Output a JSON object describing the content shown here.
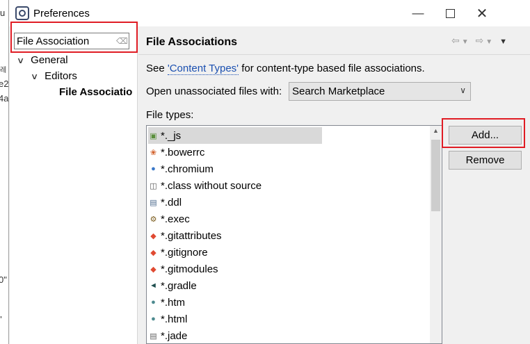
{
  "window": {
    "title": "Preferences"
  },
  "background_fragments": [
    "u",
    "레",
    "e2",
    "4a",
    "0\"",
    "\""
  ],
  "sidebar": {
    "filter_value": "File Association",
    "tree": [
      {
        "label": "General",
        "expanded": true
      },
      {
        "label": "Editors",
        "expanded": true
      },
      {
        "label": "File Associatio",
        "selected": true
      }
    ]
  },
  "page": {
    "title": "File Associations",
    "see_prefix": "See ",
    "see_link": "'Content Types'",
    "see_suffix": " for content-type based file associations.",
    "open_label": "Open unassociated files with:",
    "open_value": "Search Marketplace",
    "file_types_label": "File types:",
    "file_types": [
      {
        "name": "*._js",
        "icon": "node-js-icon",
        "selected": true
      },
      {
        "name": "*.bowerrc",
        "icon": "bower-icon"
      },
      {
        "name": "*.chromium",
        "icon": "chromium-icon"
      },
      {
        "name": "*.class without source",
        "icon": "class-file-icon"
      },
      {
        "name": "*.ddl",
        "icon": "ddl-file-icon"
      },
      {
        "name": "*.exec",
        "icon": "exec-gears-icon"
      },
      {
        "name": "*.gitattributes",
        "icon": "git-icon"
      },
      {
        "name": "*.gitignore",
        "icon": "git-icon"
      },
      {
        "name": "*.gitmodules",
        "icon": "git-icon"
      },
      {
        "name": "*.gradle",
        "icon": "gradle-icon"
      },
      {
        "name": "*.htm",
        "icon": "web-globe-icon"
      },
      {
        "name": "*.html",
        "icon": "web-globe-icon"
      },
      {
        "name": "*.jade",
        "icon": "text-file-icon"
      }
    ],
    "add_label": "Add...",
    "remove_label": "Remove"
  },
  "colors": {
    "highlight_box": "#e01c24",
    "link": "#1a4fb0",
    "selection": "#d9d9d9"
  }
}
